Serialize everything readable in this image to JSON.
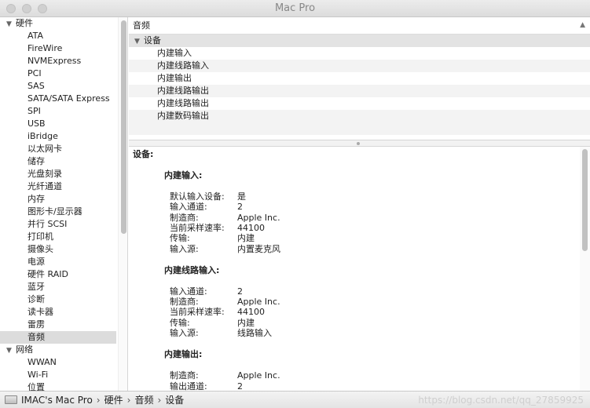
{
  "window": {
    "title": "Mac Pro"
  },
  "sidebar": {
    "rows": [
      {
        "label": "硬件",
        "type": "group"
      },
      {
        "label": "ATA",
        "type": "item"
      },
      {
        "label": "FireWire",
        "type": "item"
      },
      {
        "label": "NVMExpress",
        "type": "item"
      },
      {
        "label": "PCI",
        "type": "item"
      },
      {
        "label": "SAS",
        "type": "item"
      },
      {
        "label": "SATA/SATA Express",
        "type": "item"
      },
      {
        "label": "SPI",
        "type": "item"
      },
      {
        "label": "USB",
        "type": "item"
      },
      {
        "label": "iBridge",
        "type": "item"
      },
      {
        "label": "以太网卡",
        "type": "item"
      },
      {
        "label": "储存",
        "type": "item"
      },
      {
        "label": "光盘刻录",
        "type": "item"
      },
      {
        "label": "光纤通道",
        "type": "item"
      },
      {
        "label": "内存",
        "type": "item"
      },
      {
        "label": "图形卡/显示器",
        "type": "item"
      },
      {
        "label": "并行 SCSI",
        "type": "item"
      },
      {
        "label": "打印机",
        "type": "item"
      },
      {
        "label": "摄像头",
        "type": "item"
      },
      {
        "label": "电源",
        "type": "item"
      },
      {
        "label": "硬件 RAID",
        "type": "item"
      },
      {
        "label": "蓝牙",
        "type": "item"
      },
      {
        "label": "诊断",
        "type": "item"
      },
      {
        "label": "读卡器",
        "type": "item"
      },
      {
        "label": "雷雳",
        "type": "item"
      },
      {
        "label": "音频",
        "type": "item",
        "selected": true
      },
      {
        "label": "网络",
        "type": "group"
      },
      {
        "label": "WWAN",
        "type": "item"
      },
      {
        "label": "Wi-Fi",
        "type": "item"
      },
      {
        "label": "位置",
        "type": "item"
      }
    ]
  },
  "top_table": {
    "header": "音频",
    "group": "设备",
    "devices": [
      "内建输入",
      "内建线路输入",
      "内建输出",
      "内建线路输出",
      "内建线路输出",
      "内建数码输出"
    ]
  },
  "detail": {
    "heading": "设备:",
    "sections": [
      {
        "title": "内建输入:",
        "props": [
          {
            "key": "默认输入设备:",
            "value": "是"
          },
          {
            "key": "输入通道:",
            "value": "2"
          },
          {
            "key": "制造商:",
            "value": "Apple Inc."
          },
          {
            "key": "当前采样速率:",
            "value": "44100"
          },
          {
            "key": "传输:",
            "value": "内建"
          },
          {
            "key": "输入源:",
            "value": "内置麦克风"
          }
        ]
      },
      {
        "title": "内建线路输入:",
        "props": [
          {
            "key": "输入通道:",
            "value": "2"
          },
          {
            "key": "制造商:",
            "value": "Apple Inc."
          },
          {
            "key": "当前采样速率:",
            "value": "44100"
          },
          {
            "key": "传输:",
            "value": "内建"
          },
          {
            "key": "输入源:",
            "value": "线路输入"
          }
        ]
      },
      {
        "title": "内建输出:",
        "props": [
          {
            "key": "制造商:",
            "value": "Apple Inc."
          },
          {
            "key": "输出通道:",
            "value": "2"
          }
        ]
      }
    ]
  },
  "pathbar": {
    "computer": "IMAC's Mac Pro",
    "crumbs": [
      "硬件",
      "音频",
      "设备"
    ],
    "watermark": "https://blog.csdn.net/qq_27859925"
  }
}
